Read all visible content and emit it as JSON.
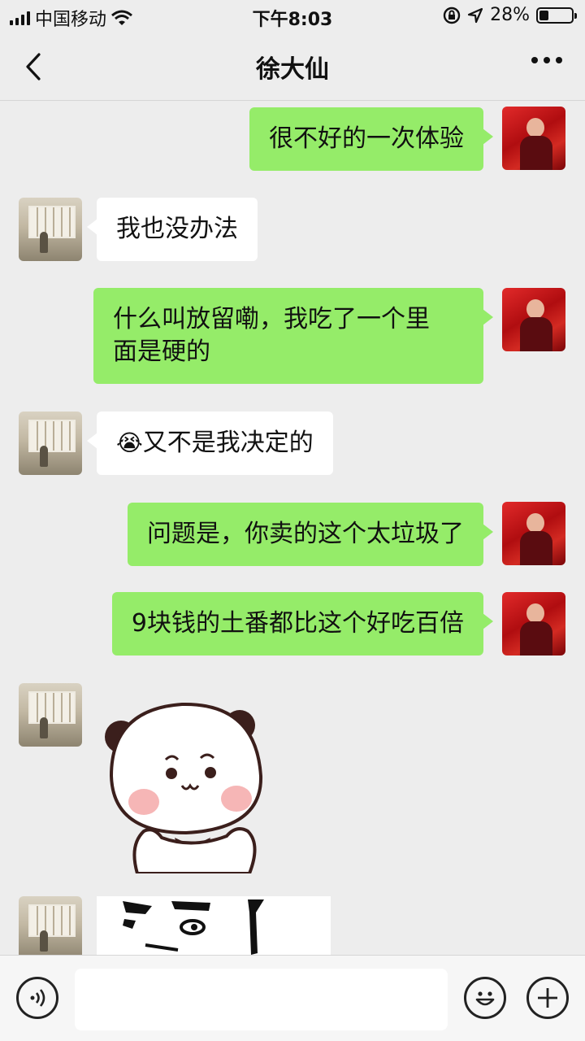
{
  "status_bar": {
    "carrier": "中国移动",
    "time": "下午8:03",
    "battery_percent": "28%",
    "battery_level": 0.28
  },
  "header": {
    "title": "徐大仙"
  },
  "messages": [
    {
      "side": "me",
      "text": "很不好的一次体验"
    },
    {
      "side": "other",
      "text": "我也没办法"
    },
    {
      "side": "me",
      "line1": "什么叫放留嘞，我吃了一个里",
      "line2": "面是硬的"
    },
    {
      "side": "other",
      "emoji": "😭",
      "text": "又不是我决定的"
    },
    {
      "side": "me",
      "text": "问题是，你卖的这个太垃圾了"
    },
    {
      "side": "me",
      "text": "9块钱的土番都比这个好吃百倍"
    },
    {
      "side": "other",
      "type": "sticker",
      "icon": "panda-bear-sticker"
    },
    {
      "side": "other",
      "type": "sticker",
      "icon": "meme-face-sticker"
    }
  ],
  "input_bar": {
    "placeholder": ""
  },
  "colors": {
    "my_bubble": "#95ec69",
    "other_bubble": "#ffffff",
    "background": "#ededed"
  }
}
